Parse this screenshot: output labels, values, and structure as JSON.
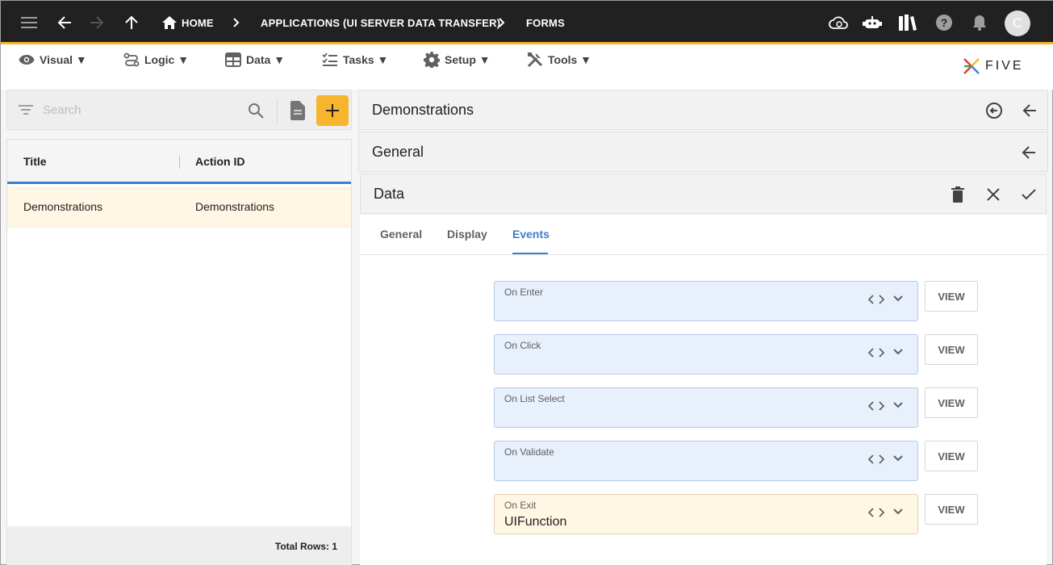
{
  "topbar": {
    "breadcrumbs": [
      "HOME",
      "APPLICATIONS (UI SERVER DATA TRANSFER)",
      "FORMS"
    ],
    "avatar_initial": "C",
    "bar_color": "#212121",
    "accent": "#f7b52c"
  },
  "menu": {
    "items": [
      {
        "label": "Visual ▼",
        "icon": "eye-icon"
      },
      {
        "label": "Logic ▼",
        "icon": "flow-icon"
      },
      {
        "label": "Data ▼",
        "icon": "table-icon"
      },
      {
        "label": "Tasks ▼",
        "icon": "checklist-icon"
      },
      {
        "label": "Setup ▼",
        "icon": "gear-icon"
      },
      {
        "label": "Tools ▼",
        "icon": "tools-icon"
      }
    ],
    "logo": "FIVE"
  },
  "list": {
    "search_placeholder": "Search",
    "columns": [
      "Title",
      "Action ID"
    ],
    "rows": [
      {
        "title": "Demonstrations",
        "action_id": "Demonstrations"
      }
    ],
    "footer": "Total Rows: 1"
  },
  "panels": {
    "record_title": "Demonstrations",
    "general_title": "General",
    "data_title": "Data"
  },
  "tabs": {
    "items": [
      "General",
      "Display",
      "Events"
    ],
    "active": "Events",
    "active_color": "#3f7fcb"
  },
  "events": [
    {
      "label": "On Enter",
      "value": "",
      "button": "VIEW"
    },
    {
      "label": "On Click",
      "value": "",
      "button": "VIEW"
    },
    {
      "label": "On List Select",
      "value": "",
      "button": "VIEW"
    },
    {
      "label": "On Validate",
      "value": "",
      "button": "VIEW"
    },
    {
      "label": "On Exit",
      "value": "UIFunction",
      "button": "VIEW"
    }
  ]
}
